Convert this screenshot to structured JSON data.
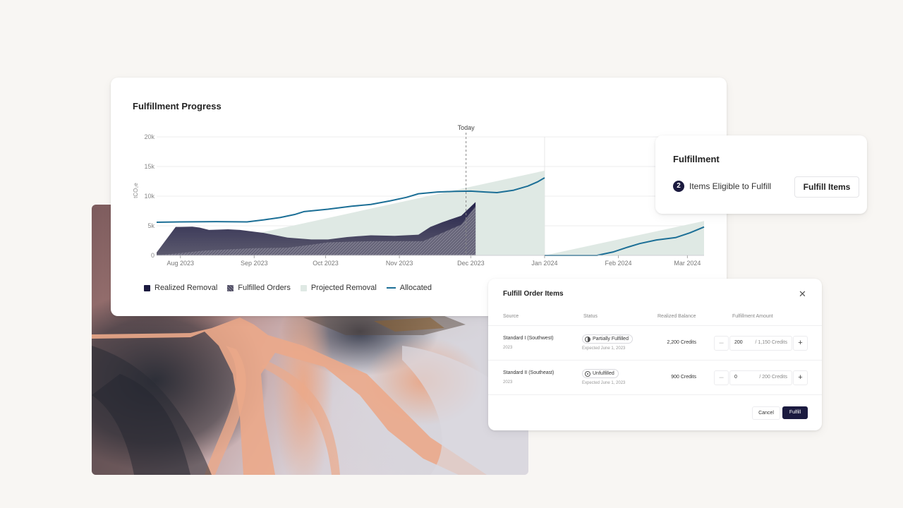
{
  "colors": {
    "background": "#f8f6f3",
    "realized": "#1b1a3f",
    "fulfilled": "#5d5b70",
    "projected": "#dfe9e4",
    "allocated": "#1c6f96",
    "primary_button": "#1b1a3f"
  },
  "chart_card": {
    "title": "Fulfillment Progress",
    "today_label": "Today"
  },
  "chart_data": {
    "type": "area",
    "title": "Fulfillment Progress",
    "ylabel": "tCO₂e",
    "xlabel": "",
    "x_unit": "days since Aug 1, 2023",
    "ylim": [
      0,
      20000
    ],
    "xlim": [
      -10,
      220
    ],
    "yticks": [
      0,
      5000,
      10000,
      15000,
      20000
    ],
    "ytick_labels": [
      "0",
      "5k",
      "10k",
      "15k",
      "20k"
    ],
    "xticks": [
      0,
      31,
      61,
      92,
      122,
      153,
      184,
      213
    ],
    "xtick_labels": [
      "Aug 2023",
      "Sep 2023",
      "Oct 2023",
      "Nov 2023",
      "Dec 2023",
      "Jan 2024",
      "Feb 2024",
      "Mar 2024"
    ],
    "grid": true,
    "today_x": 120,
    "period_break_x": 153,
    "legend_position": "bottom-left",
    "series": [
      {
        "name": "Projected Removal",
        "kind": "area",
        "segments": [
          {
            "x": [
              -10,
              153
            ],
            "y": [
              0,
              14300
            ]
          },
          {
            "x": [
              153,
              220
            ],
            "y": [
              0,
              5800
            ]
          }
        ]
      },
      {
        "name": "Realized Removal",
        "kind": "area",
        "x": [
          -10,
          -2,
          0,
          5,
          8,
          12,
          20,
          25,
          35,
          45,
          55,
          62,
          70,
          80,
          90,
          100,
          105,
          110,
          118,
          124,
          124
        ],
        "y": [
          500,
          4800,
          4800,
          4850,
          4700,
          4300,
          4400,
          4300,
          3800,
          3000,
          2700,
          2700,
          3100,
          3400,
          3300,
          3500,
          4800,
          5600,
          6700,
          9000,
          0
        ]
      },
      {
        "name": "Fulfilled Orders",
        "kind": "hatched-area",
        "x": [
          -10,
          10,
          30,
          45,
          55,
          62,
          80,
          102,
          110,
          118,
          124,
          124
        ],
        "y": [
          0,
          800,
          1200,
          1300,
          1800,
          2200,
          2400,
          2400,
          3800,
          5200,
          8300,
          0
        ]
      },
      {
        "name": "Allocated",
        "kind": "line",
        "segments": [
          {
            "x": [
              -10,
              0,
              15,
              28,
              35,
              42,
              48,
              52,
              62,
              72,
              80,
              88,
              95,
              100,
              108,
              115,
              122,
              128,
              133,
              140,
              146,
              150,
              153
            ],
            "y": [
              5600,
              5650,
              5700,
              5650,
              6000,
              6400,
              6900,
              7400,
              7800,
              8300,
              8600,
              9200,
              9800,
              10400,
              10700,
              10800,
              10850,
              10700,
              10600,
              11000,
              11700,
              12400,
              13100
            ]
          },
          {
            "x": [
              153,
              165,
              175,
              182,
              188,
              193,
              200,
              208,
              214,
              220
            ],
            "y": [
              0,
              0,
              0,
              600,
              1400,
              2000,
              2600,
              3000,
              3800,
              4800
            ]
          }
        ]
      }
    ]
  },
  "legend": [
    {
      "label": "Realized Removal",
      "swatch": "solid"
    },
    {
      "label": "Fulfilled Orders",
      "swatch": "hatched"
    },
    {
      "label": "Projected Removal",
      "swatch": "light"
    },
    {
      "label": "Allocated",
      "swatch": "line"
    }
  ],
  "fulfillment_card": {
    "title": "Fulfillment",
    "eligible_count": "2",
    "eligible_text": "Items Eligible to Fulfill",
    "button_label": "Fulfill Items"
  },
  "modal": {
    "title": "Fulfill Order Items",
    "close_icon": "✕",
    "columns": [
      "Source",
      "Status",
      "Realized Balance",
      "Fulfillment Amount"
    ],
    "rows": [
      {
        "source": "Standard I (Southwest)",
        "year": "2023",
        "status": "Partially Fulfilled",
        "status_icon": "half-circle-icon",
        "expected": "Expected June 1, 2023",
        "balance": "2,200 Credits",
        "amount": "200",
        "max": "/ 1,150 Credits"
      },
      {
        "source": "Standard II (Southeast)",
        "year": "2023",
        "status": "Unfulfilled",
        "status_icon": "dot-circle-icon",
        "expected": "Expected June 1, 2023",
        "balance": "900 Credits",
        "amount": "0",
        "max": "/ 200 Credits"
      }
    ],
    "minus_label": "–",
    "plus_label": "+",
    "cancel_label": "Cancel",
    "fulfill_label": "Fulfill"
  }
}
